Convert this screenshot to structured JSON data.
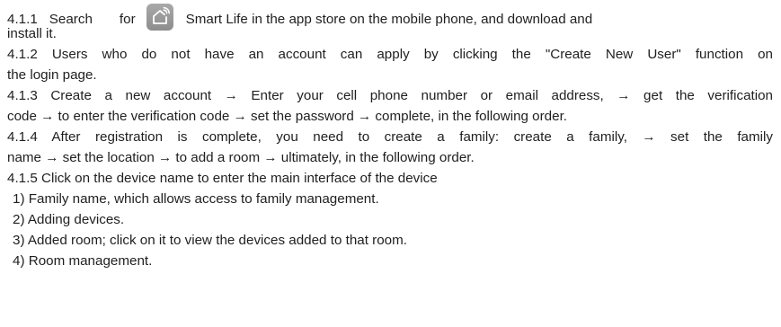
{
  "section_4_1_1": {
    "number": "4.1.1",
    "word_search": "Search",
    "word_for": "for",
    "icon_name": "smart-life-app-icon",
    "text_after_icon": "Smart Life in the app store on the mobile phone, and download and",
    "continuation": "install it."
  },
  "section_4_1_2": {
    "line1": "4.1.2 Users who do not have an account can apply by clicking the \"Create New User\" function on",
    "line2": "the login page."
  },
  "section_4_1_3": {
    "line1": "4.1.3 Create a new account → Enter your cell phone number or email address, → get the verification",
    "line2": "code → to enter the verification code → set the password → complete, in the following order."
  },
  "section_4_1_4": {
    "line1": "4.1.4 After registration is complete, you need to create a family: create a family, → set the family",
    "line2": "name → set the location → to add a room → ultimately, in the following order."
  },
  "section_4_1_5": {
    "line1": "4.1.5 Click on the device name to enter the main interface of the device",
    "items": [
      "1) Family name, which allows access to family management.",
      "2) Adding devices.",
      "3) Added room; click on it to view the devices added to that room.",
      "4) Room management."
    ]
  }
}
